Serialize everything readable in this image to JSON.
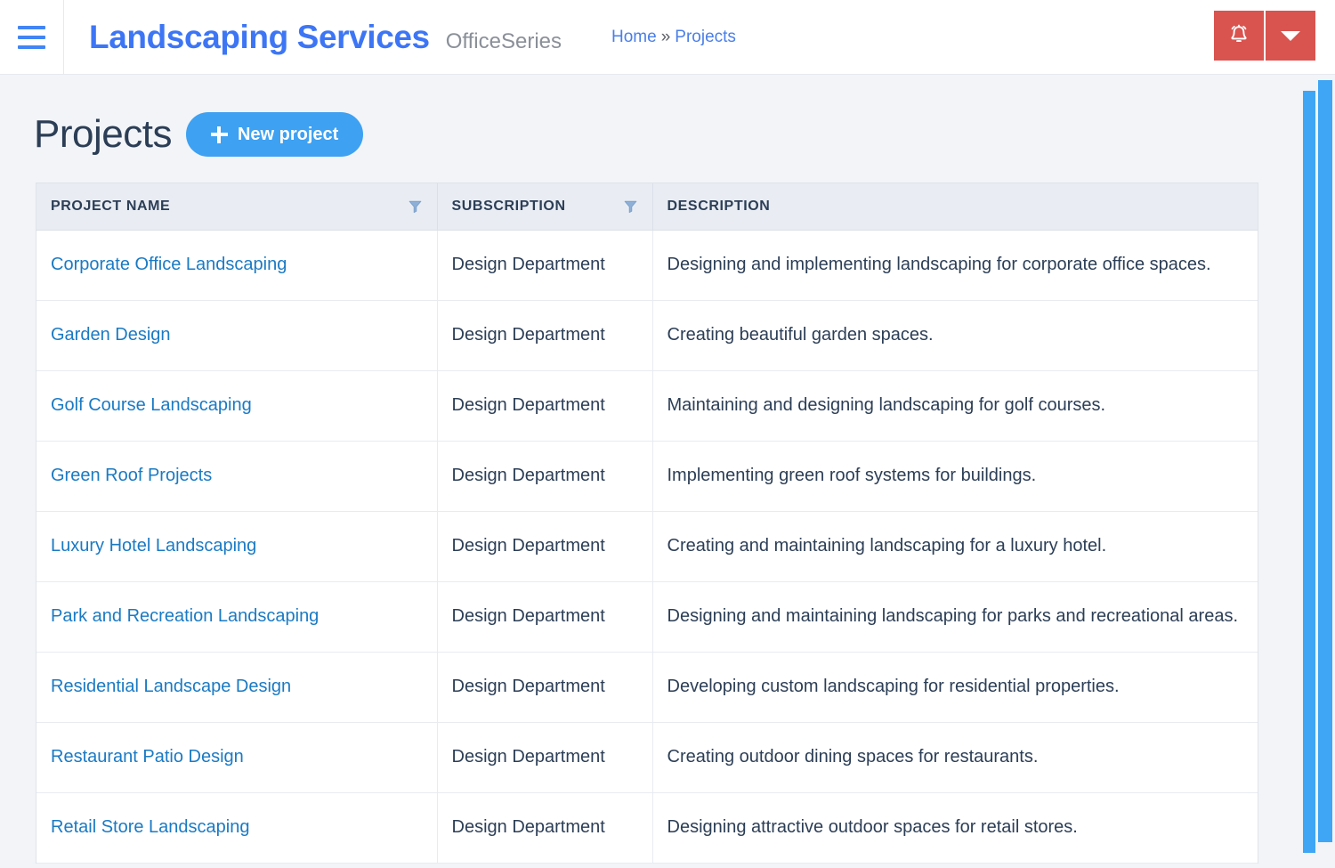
{
  "header": {
    "menu_icon": "hamburger-icon",
    "brand_title": "Landscaping Services",
    "brand_subtitle": "OfficeSeries",
    "breadcrumb": {
      "home": "Home",
      "separator": "»",
      "current": "Projects"
    },
    "actions": {
      "notifications_icon": "bell-icon",
      "dropdown_icon": "caret-down-icon"
    },
    "colors": {
      "brand_blue": "#3d76f5",
      "action_red": "#d9534f"
    }
  },
  "page": {
    "title": "Projects",
    "new_button_label": "New project",
    "new_button_icon": "plus-icon",
    "new_button_color": "#3ea1f2"
  },
  "table": {
    "columns": [
      {
        "label": "PROJECT NAME",
        "filterable": true
      },
      {
        "label": "SUBSCRIPTION",
        "filterable": true
      },
      {
        "label": "DESCRIPTION",
        "filterable": false
      }
    ],
    "rows": [
      {
        "name": "Corporate Office Landscaping",
        "subscription": "Design Department",
        "description": "Designing and implementing landscaping for corporate office spaces."
      },
      {
        "name": "Garden Design",
        "subscription": "Design Department",
        "description": "Creating beautiful garden spaces."
      },
      {
        "name": "Golf Course Landscaping",
        "subscription": "Design Department",
        "description": "Maintaining and designing landscaping for golf courses."
      },
      {
        "name": "Green Roof Projects",
        "subscription": "Design Department",
        "description": "Implementing green roof systems for buildings."
      },
      {
        "name": "Luxury Hotel Landscaping",
        "subscription": "Design Department",
        "description": "Creating and maintaining landscaping for a luxury hotel."
      },
      {
        "name": "Park and Recreation Landscaping",
        "subscription": "Design Department",
        "description": "Designing and maintaining landscaping for parks and recreational areas."
      },
      {
        "name": "Residential Landscape Design",
        "subscription": "Design Department",
        "description": "Developing custom landscaping for residential properties."
      },
      {
        "name": "Restaurant Patio Design",
        "subscription": "Design Department",
        "description": "Creating outdoor dining spaces for restaurants."
      },
      {
        "name": "Retail Store Landscaping",
        "subscription": "Design Department",
        "description": "Designing attractive outdoor spaces for retail stores."
      }
    ]
  },
  "scrollbars": {
    "inner": {
      "icon": "vertical-scrollbar",
      "color": "#3ea6f5"
    },
    "outer": {
      "icon": "vertical-scrollbar",
      "color": "#3ea6f5"
    }
  }
}
